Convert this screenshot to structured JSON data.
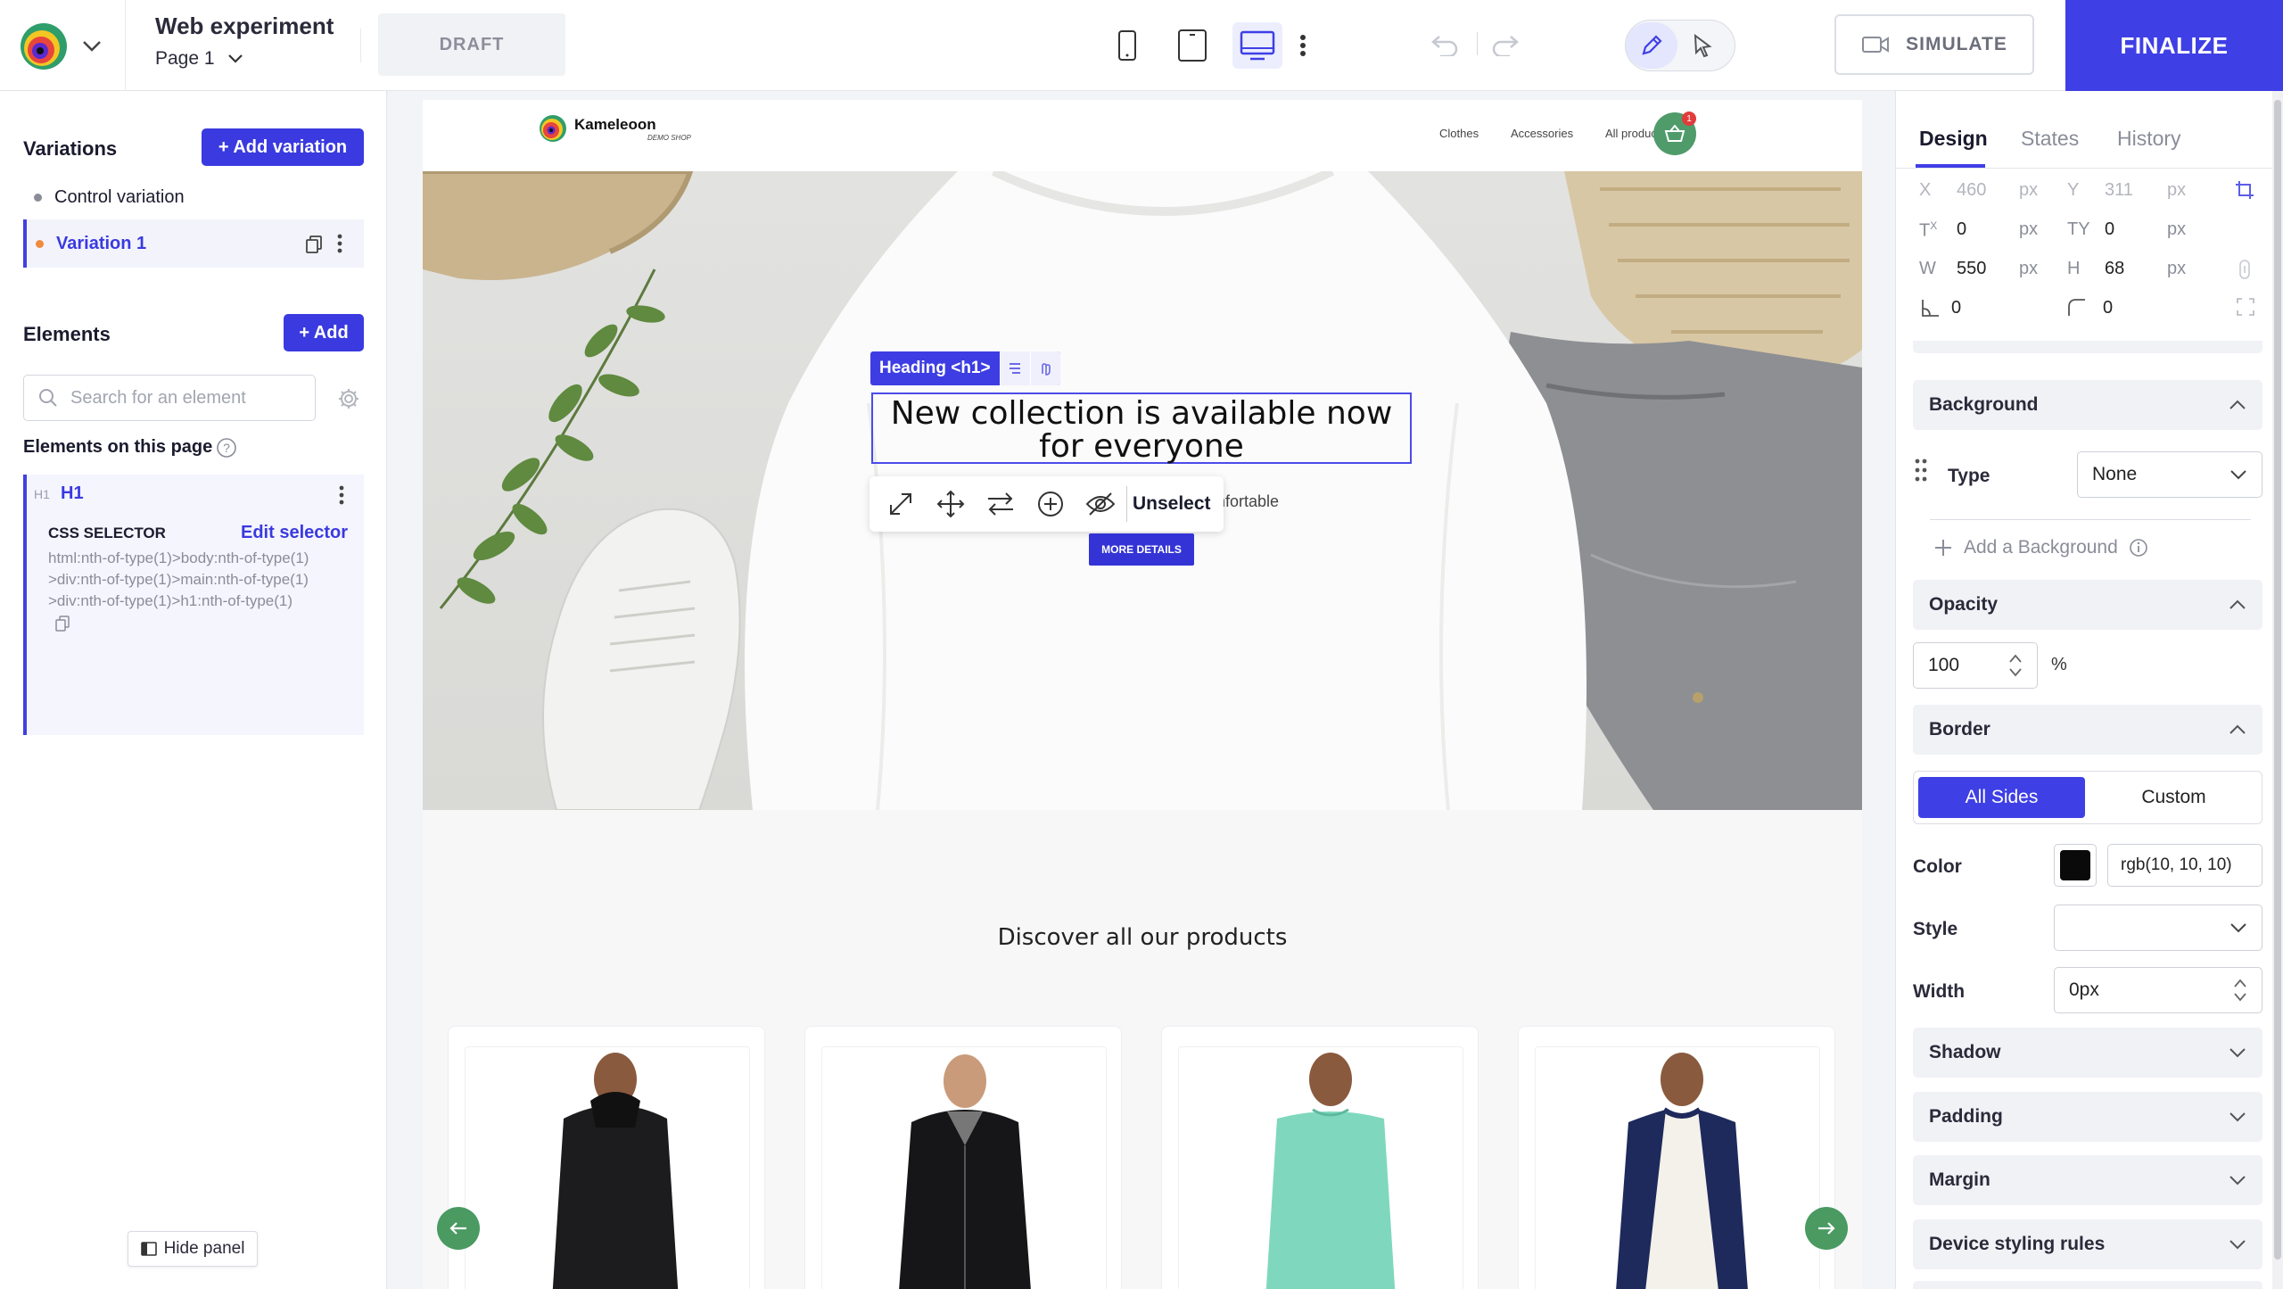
{
  "topbar": {
    "experiment_title": "Web experiment",
    "page": "Page 1",
    "status": "DRAFT",
    "simulate": "SIMULATE",
    "finalize": "FINALIZE",
    "icons": [
      "kameleoon-logo",
      "mobile-icon",
      "tablet-icon",
      "desktop-icon",
      "more-icon",
      "undo-icon",
      "redo-icon",
      "pencil-icon",
      "cursor-icon",
      "simulate-icon"
    ]
  },
  "left": {
    "variations_title": "Variations",
    "add_variation": "+ Add variation",
    "variations": [
      {
        "label": "Control variation",
        "color": "#8a8d98"
      },
      {
        "label": "Variation 1",
        "color": "#f08a3c"
      }
    ],
    "elements_title": "Elements",
    "add": "+ Add",
    "search_placeholder": "Search for an element",
    "on_page_title": "Elements on this page",
    "element": {
      "tag": "H1",
      "tag_small": "H1",
      "css_label": "CSS SELECTOR",
      "edit_selector": "Edit selector",
      "selector": "html:nth-of-type(1)>body:nth-of-type(1)>div:nth-of-type(1)>main:nth-of-type(1)>div:nth-of-type(1)>h1:nth-of-type(1)"
    },
    "hide_panel": "Hide panel"
  },
  "site": {
    "brand": "Kameleoon",
    "brand_sub": "DEMO SHOP",
    "nav": [
      "Clothes",
      "Accessories",
      "All products"
    ],
    "cart_count": "1",
    "hero_title": "New collection is available now for everyone",
    "hero_sub_visible": "mfortable",
    "more_details": "MORE DETAILS",
    "selection_label": "Heading <h1>",
    "unselect": "Unselect",
    "discover": "Discover all our products",
    "products": [
      "black hoodie",
      "black zip jacket",
      "mint long sleeve",
      "navy raglan"
    ]
  },
  "right": {
    "tabs": [
      "Design",
      "States",
      "History"
    ],
    "active_tab": "Design",
    "x_label": "X",
    "x": "460",
    "y_label": "Y",
    "y": "311",
    "tx_label": "T",
    "tx": "0",
    "ty_label": "TY",
    "ty": "0",
    "w_label": "W",
    "w": "550",
    "h_label": "H",
    "h": "68",
    "rotate": "0",
    "radius": "0",
    "unit": "px",
    "background": "Background",
    "type_label": "Type",
    "type_value": "None",
    "add_background": "Add a Background",
    "opacity": "Opacity",
    "opacity_value": "100",
    "percent": "%",
    "border": "Border",
    "all_sides": "All Sides",
    "custom": "Custom",
    "color_label": "Color",
    "color_value": "rgb(10, 10, 10)",
    "style_label": "Style",
    "width_label": "Width",
    "width_value": "0px",
    "sections": [
      "Shadow",
      "Padding",
      "Margin",
      "Device styling rules"
    ],
    "accent": "#3f3fe6"
  }
}
